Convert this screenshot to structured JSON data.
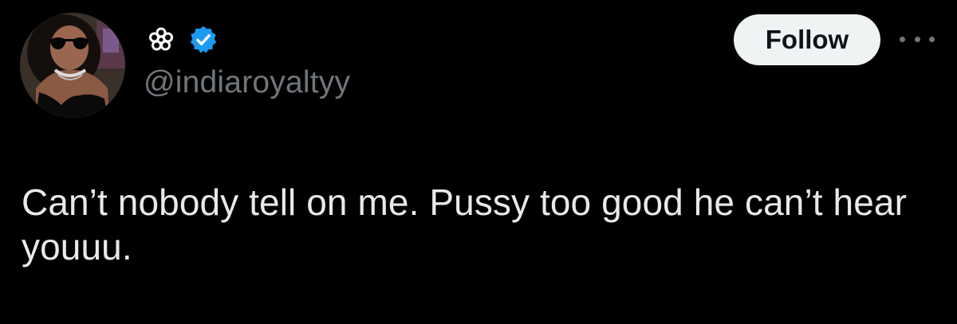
{
  "author": {
    "name_icon": "flower-icon",
    "verified_icon": "verified-badge-icon",
    "handle": "@indiaroyaltyy",
    "avatar": "profile-photo"
  },
  "actions": {
    "follow_label": "Follow",
    "more_icon": "more-options-icon"
  },
  "tweet": {
    "text": "Can’t nobody tell on me. Pussy too good he can’t hear youuu."
  },
  "colors": {
    "background": "#000000",
    "text": "#e7e9ea",
    "secondary_text": "#71767b",
    "verified": "#1d9bf0",
    "button_bg": "#eff3f4",
    "button_text": "#0f1419"
  }
}
